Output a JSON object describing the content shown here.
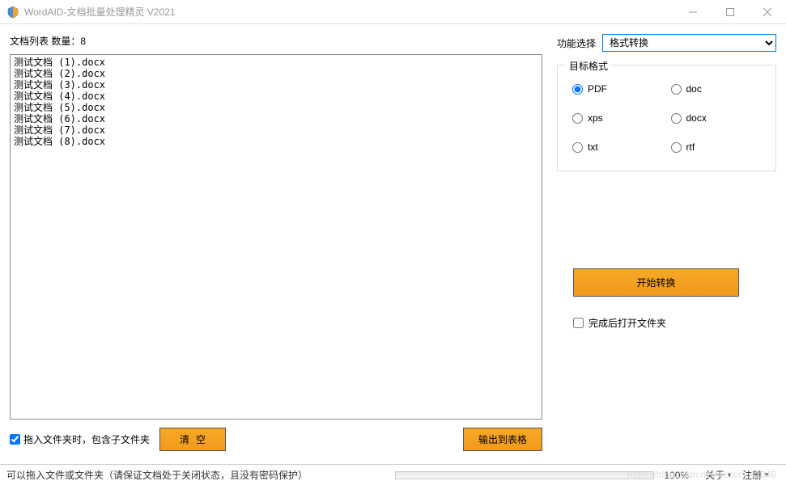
{
  "window": {
    "title": "WordAID-文档批量处理精灵 V2021"
  },
  "left": {
    "listLabel": "文档列表  数量：8",
    "files": [
      "测试文档 (1).docx",
      "测试文档 (2).docx",
      "测试文档 (3).docx",
      "测试文档 (4).docx",
      "测试文档 (5).docx",
      "测试文档 (6).docx",
      "测试文档 (7).docx",
      "测试文档 (8).docx"
    ],
    "includeSubfolders": "拖入文件夹时，包含子文件夹",
    "clearBtn": "清空",
    "exportBtn": "输出到表格"
  },
  "right": {
    "funcLabel": "功能选择",
    "funcValue": "格式转换",
    "formatGroupTitle": "目标格式",
    "formats": {
      "pdf": "PDF",
      "doc": "doc",
      "xps": "xps",
      "docx": "docx",
      "txt": "txt",
      "rtf": "rtf"
    },
    "selectedFormat": "pdf",
    "startBtn": "开始转换",
    "openFolderAfter": "完成后打开文件夹"
  },
  "status": {
    "hint": "可以拖入文件或文件夹（请保证文档处于关闭状态，且没有密码保护）",
    "percent": "100%",
    "about": "关于",
    "register": "注册"
  },
  "watermark": "https://blog.csdn.net/weixin_42046"
}
